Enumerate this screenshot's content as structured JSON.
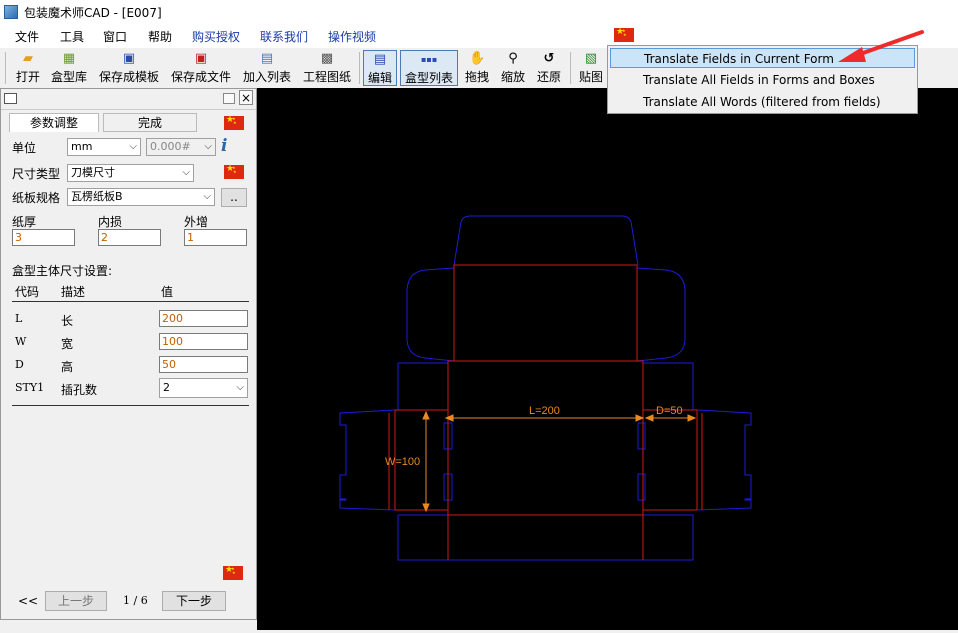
{
  "window": {
    "title": "包装魔术师CAD - [E007]"
  },
  "menu": {
    "items": [
      {
        "label": "文件",
        "blue": false
      },
      {
        "label": "工具",
        "blue": false
      },
      {
        "label": "窗口",
        "blue": false
      },
      {
        "label": "帮助",
        "blue": false
      },
      {
        "label": "购买授权",
        "blue": true
      },
      {
        "label": "联系我们",
        "blue": true
      },
      {
        "label": "操作视频",
        "blue": true
      }
    ]
  },
  "toolbar": {
    "open": "打开",
    "library": "盒型库",
    "save_template": "保存成模板",
    "save_file": "保存成文件",
    "add_list": "加入列表",
    "drawing": "工程图纸",
    "edit": "编辑",
    "box_list": "盒型列表",
    "drag": "拖拽",
    "zoom": "缩放",
    "restore": "还原",
    "paste": "贴图"
  },
  "panel": {
    "tab_params": "参数调整",
    "tab_done": "完成",
    "unit_label": "单位",
    "unit_value": "mm",
    "format_value": "0.000#",
    "size_type_label": "尺寸类型",
    "size_type_value": "刀模尺寸",
    "board_label": "纸板规格",
    "board_value": "瓦楞纸板B",
    "board_btn": "..",
    "thickness_label": "纸厚",
    "thickness_value": "3",
    "inner_loss_label": "内损",
    "inner_loss_value": "2",
    "outer_add_label": "外增",
    "outer_add_value": "1",
    "section_title": "盒型主体尺寸设置:",
    "col_code": "代码",
    "col_desc": "描述",
    "col_value": "值",
    "rows": [
      {
        "code": "L",
        "desc": "长",
        "value": "200"
      },
      {
        "code": "W",
        "desc": "宽",
        "value": "100"
      },
      {
        "code": "D",
        "desc": "高",
        "value": "50"
      },
      {
        "code": "STY1",
        "desc": "插孔数",
        "value": "2"
      }
    ],
    "nav_first": "<<",
    "nav_prev": "上一步",
    "page": "1 / 6",
    "nav_next": "下一步"
  },
  "drawing": {
    "dim_l": "L=200",
    "dim_d": "D=50",
    "dim_w": "W=100",
    "colors": {
      "outline": "#1c1cd8",
      "fold": "#d01818",
      "dim": "#e88a20"
    }
  },
  "popup": {
    "items": [
      "Translate Fields in Current Form",
      "Translate All Fields in Forms and Boxes",
      "Translate All Words (filtered from fields)"
    ]
  }
}
